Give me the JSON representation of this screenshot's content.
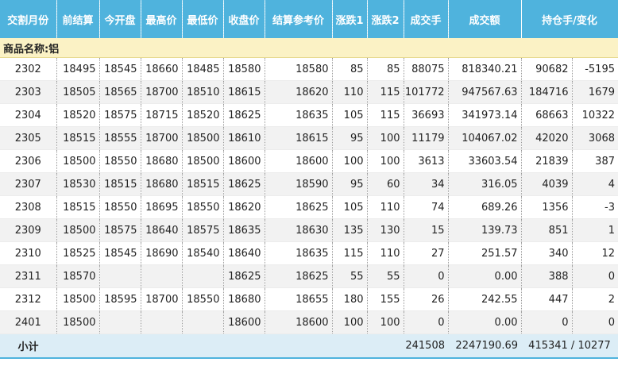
{
  "header": {
    "columns": [
      "交割月份",
      "前结算",
      "今开盘",
      "最高价",
      "最低价",
      "收盘价",
      "结算参考价",
      "涨跌1",
      "涨跌2",
      "成交手",
      "成交额",
      "持仓手/变化"
    ]
  },
  "section": {
    "title": "商品名称:铝"
  },
  "rows": [
    {
      "month": "2302",
      "prev": "18495",
      "open": "18545",
      "high": "18660",
      "low": "18485",
      "close": "18580",
      "settle": "18580",
      "chg1": "85",
      "chg2": "85",
      "vol": "88075",
      "turnover": "818340.21",
      "oi": "90682",
      "oi_chg": "-5195"
    },
    {
      "month": "2303",
      "prev": "18505",
      "open": "18565",
      "high": "18700",
      "low": "18510",
      "close": "18615",
      "settle": "18620",
      "chg1": "110",
      "chg2": "115",
      "vol": "101772",
      "turnover": "947567.63",
      "oi": "184716",
      "oi_chg": "1679"
    },
    {
      "month": "2304",
      "prev": "18520",
      "open": "18575",
      "high": "18715",
      "low": "18520",
      "close": "18625",
      "settle": "18635",
      "chg1": "105",
      "chg2": "115",
      "vol": "36693",
      "turnover": "341973.14",
      "oi": "68663",
      "oi_chg": "10322"
    },
    {
      "month": "2305",
      "prev": "18515",
      "open": "18555",
      "high": "18700",
      "low": "18500",
      "close": "18610",
      "settle": "18615",
      "chg1": "95",
      "chg2": "100",
      "vol": "11179",
      "turnover": "104067.02",
      "oi": "42020",
      "oi_chg": "3068"
    },
    {
      "month": "2306",
      "prev": "18500",
      "open": "18550",
      "high": "18680",
      "low": "18500",
      "close": "18600",
      "settle": "18600",
      "chg1": "100",
      "chg2": "100",
      "vol": "3613",
      "turnover": "33603.54",
      "oi": "21839",
      "oi_chg": "387"
    },
    {
      "month": "2307",
      "prev": "18530",
      "open": "18515",
      "high": "18680",
      "low": "18515",
      "close": "18625",
      "settle": "18590",
      "chg1": "95",
      "chg2": "60",
      "vol": "34",
      "turnover": "316.05",
      "oi": "4039",
      "oi_chg": "4"
    },
    {
      "month": "2308",
      "prev": "18515",
      "open": "18550",
      "high": "18695",
      "low": "18550",
      "close": "18620",
      "settle": "18625",
      "chg1": "105",
      "chg2": "110",
      "vol": "74",
      "turnover": "689.26",
      "oi": "1356",
      "oi_chg": "-3"
    },
    {
      "month": "2309",
      "prev": "18500",
      "open": "18575",
      "high": "18640",
      "low": "18575",
      "close": "18635",
      "settle": "18630",
      "chg1": "135",
      "chg2": "130",
      "vol": "15",
      "turnover": "139.73",
      "oi": "851",
      "oi_chg": "1"
    },
    {
      "month": "2310",
      "prev": "18525",
      "open": "18545",
      "high": "18690",
      "low": "18540",
      "close": "18640",
      "settle": "18635",
      "chg1": "115",
      "chg2": "110",
      "vol": "27",
      "turnover": "251.57",
      "oi": "340",
      "oi_chg": "12"
    },
    {
      "month": "2311",
      "prev": "18570",
      "open": "",
      "high": "",
      "low": "",
      "close": "18625",
      "settle": "18625",
      "chg1": "55",
      "chg2": "55",
      "vol": "0",
      "turnover": "0.00",
      "oi": "388",
      "oi_chg": "0"
    },
    {
      "month": "2312",
      "prev": "18500",
      "open": "18595",
      "high": "18700",
      "low": "18550",
      "close": "18680",
      "settle": "18655",
      "chg1": "180",
      "chg2": "155",
      "vol": "26",
      "turnover": "242.55",
      "oi": "447",
      "oi_chg": "2"
    },
    {
      "month": "2401",
      "prev": "18500",
      "open": "",
      "high": "",
      "low": "",
      "close": "18600",
      "settle": "18600",
      "chg1": "100",
      "chg2": "100",
      "vol": "0",
      "turnover": "0.00",
      "oi": "0",
      "oi_chg": "0"
    }
  ],
  "subtotal": {
    "label": "小计",
    "vol": "241508",
    "turnover": "2247190.69",
    "oi": "415341 / 10277"
  },
  "colors": {
    "header_bg": "#4fb3dd",
    "section_bg": "#fbf2c5",
    "subtotal_bg": "#dcedf6",
    "row_alt_bg": "#f2f2f2"
  }
}
